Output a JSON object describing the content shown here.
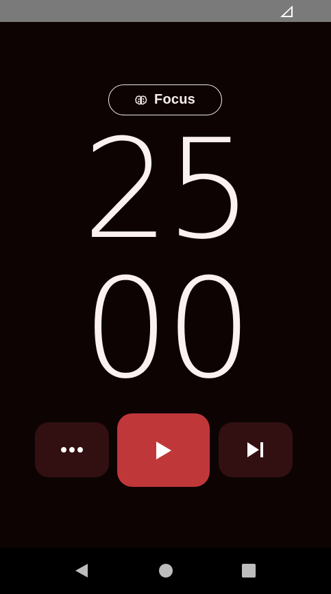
{
  "status_bar": {
    "signal_icon": "cell-signal-icon"
  },
  "mode": {
    "label": "Focus",
    "icon": "brain-icon"
  },
  "timer": {
    "minutes": "25",
    "seconds": "00"
  },
  "controls": {
    "more_icon": "more-horizontal-icon",
    "play_icon": "play-icon",
    "skip_icon": "skip-next-icon"
  },
  "nav": {
    "back_icon": "back-triangle-icon",
    "home_icon": "home-circle-icon",
    "recents_icon": "recents-square-icon"
  },
  "colors": {
    "background": "#0d0303",
    "status_bar": "#7a7a7a",
    "accent": "#c0373a",
    "secondary_button": "#321011",
    "text": "#fbf1f0"
  }
}
